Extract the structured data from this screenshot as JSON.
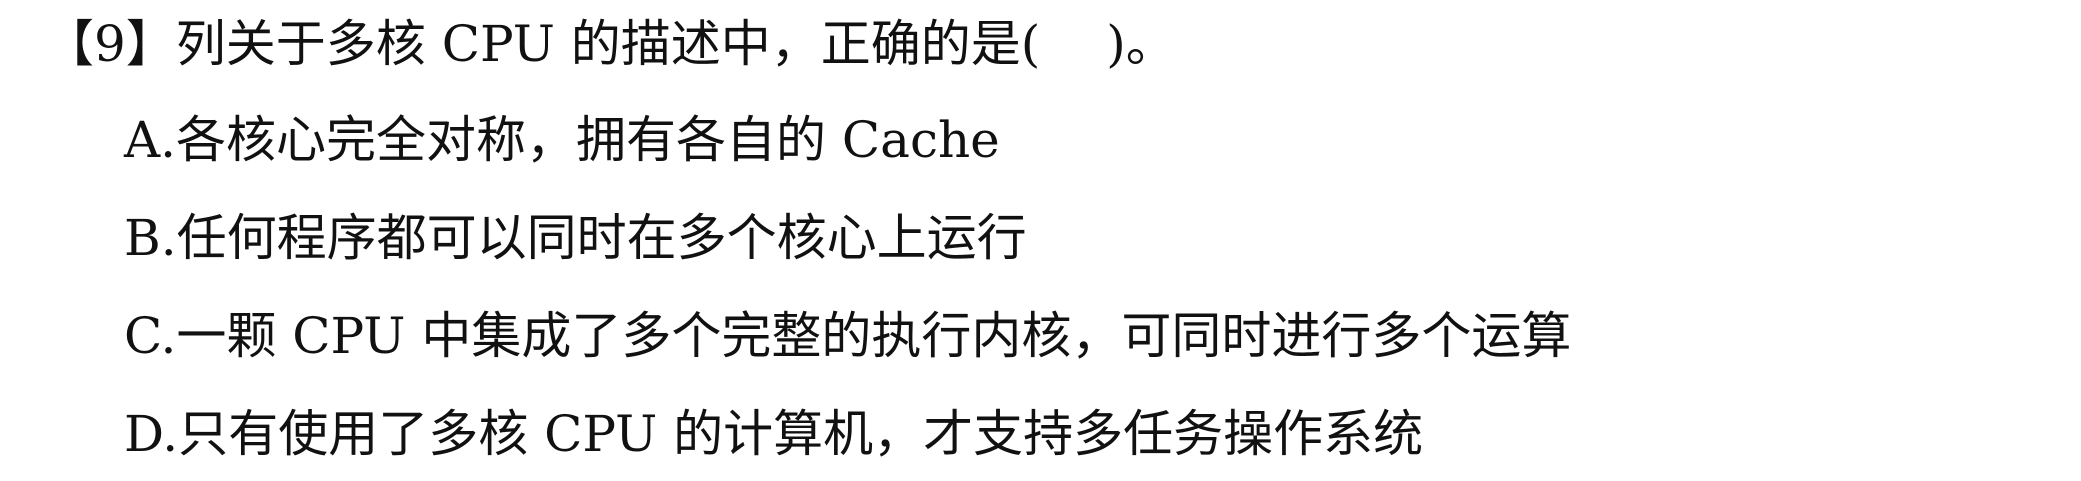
{
  "question": {
    "prefix": "【9】列关于多核 CPU 的描述中，正确的是(",
    "suffix": ")。"
  },
  "options": [
    {
      "text": "A.各核心完全对称，拥有各自的 Cache"
    },
    {
      "text": "B.任何程序都可以同时在多个核心上运行"
    },
    {
      "text": "C.一颗 CPU 中集成了多个完整的执行内核，可同时进行多个运算"
    },
    {
      "text": "D.只有使用了多核 CPU 的计算机，才支持多任务操作系统"
    }
  ]
}
